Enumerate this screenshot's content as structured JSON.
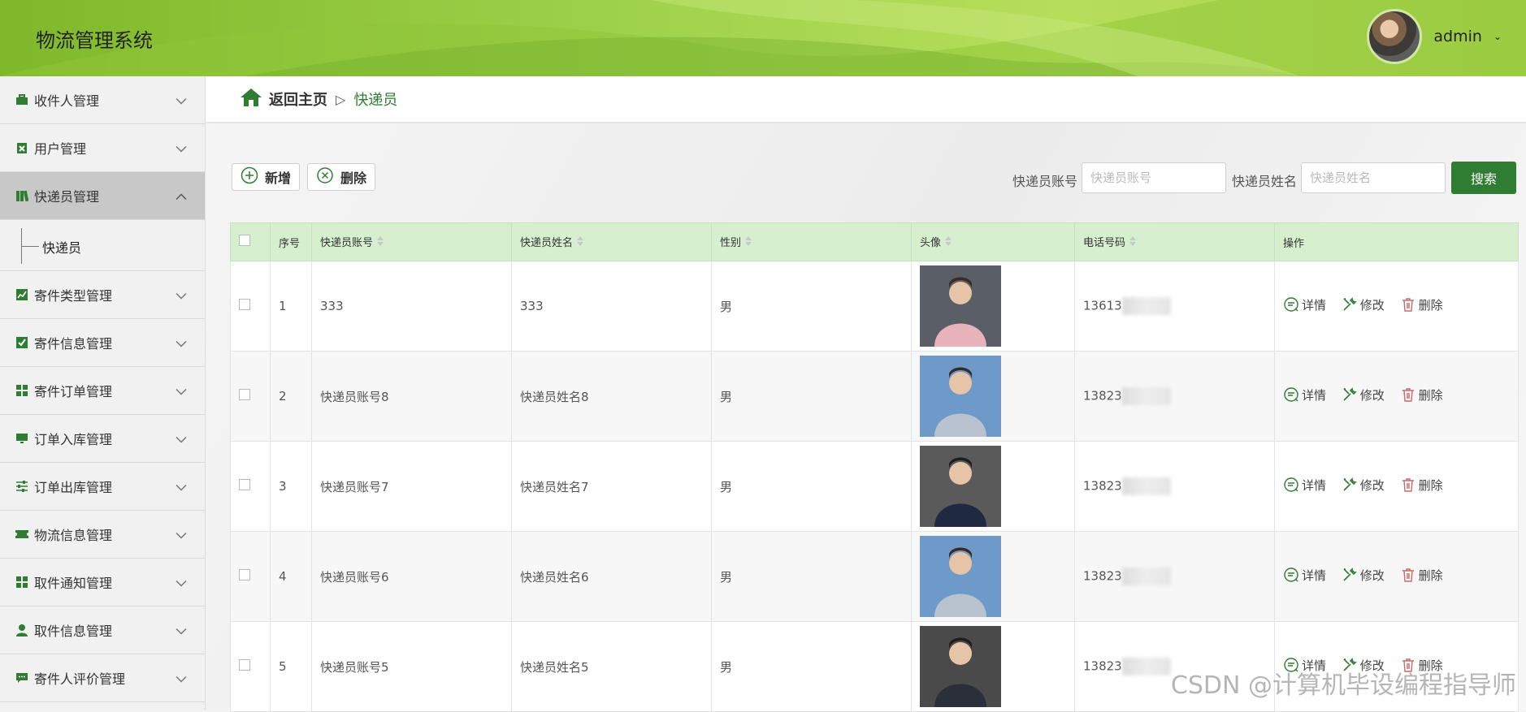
{
  "app": {
    "title": "物流管理系统",
    "user": "admin"
  },
  "sidebar": {
    "items": [
      {
        "label": "收件人管理",
        "icon": "briefcase-icon"
      },
      {
        "label": "用户管理",
        "icon": "clipboard-x-icon"
      },
      {
        "label": "快递员管理",
        "icon": "books-icon",
        "active": true,
        "sub": [
          "快递员"
        ]
      },
      {
        "label": "寄件类型管理",
        "icon": "chart-icon"
      },
      {
        "label": "寄件信息管理",
        "icon": "check-square-icon"
      },
      {
        "label": "寄件订单管理",
        "icon": "grid-icon"
      },
      {
        "label": "订单入库管理",
        "icon": "monitor-icon"
      },
      {
        "label": "订单出库管理",
        "icon": "sliders-icon"
      },
      {
        "label": "物流信息管理",
        "icon": "ticket-icon"
      },
      {
        "label": "取件通知管理",
        "icon": "grid-icon"
      },
      {
        "label": "取件信息管理",
        "icon": "user-icon"
      },
      {
        "label": "寄件人评价管理",
        "icon": "comment-icon"
      }
    ]
  },
  "breadcrumb": {
    "home": "返回主页",
    "separator": "▷",
    "current": "快递员"
  },
  "toolbar": {
    "add": "新增",
    "delete": "删除"
  },
  "search": {
    "account_label": "快递员账号",
    "account_placeholder": "快递员账号",
    "name_label": "快递员姓名",
    "name_placeholder": "快递员姓名",
    "button": "搜索"
  },
  "table": {
    "headers": [
      "序号",
      "快递员账号",
      "快递员姓名",
      "性别",
      "头像",
      "电话号码",
      "操作"
    ],
    "rows": [
      {
        "no": "1",
        "account": "333",
        "name": "333",
        "gender": "男",
        "phone": "13613"
      },
      {
        "no": "2",
        "account": "快递员账号8",
        "name": "快递员姓名8",
        "gender": "男",
        "phone": "13823"
      },
      {
        "no": "3",
        "account": "快递员账号7",
        "name": "快递员姓名7",
        "gender": "男",
        "phone": "13823"
      },
      {
        "no": "4",
        "account": "快递员账号6",
        "name": "快递员姓名6",
        "gender": "男",
        "phone": "13823"
      },
      {
        "no": "5",
        "account": "快递员账号5",
        "name": "快递员姓名5",
        "gender": "男",
        "phone": "13823"
      }
    ],
    "ops": {
      "detail": "详情",
      "edit": "修改",
      "delete": "删除"
    }
  },
  "watermark": "CSDN @计算机毕设编程指导师",
  "colors": {
    "accent": "#2e7d32",
    "header_bg": "#9ed14a",
    "th_bg": "#d6efcf"
  }
}
